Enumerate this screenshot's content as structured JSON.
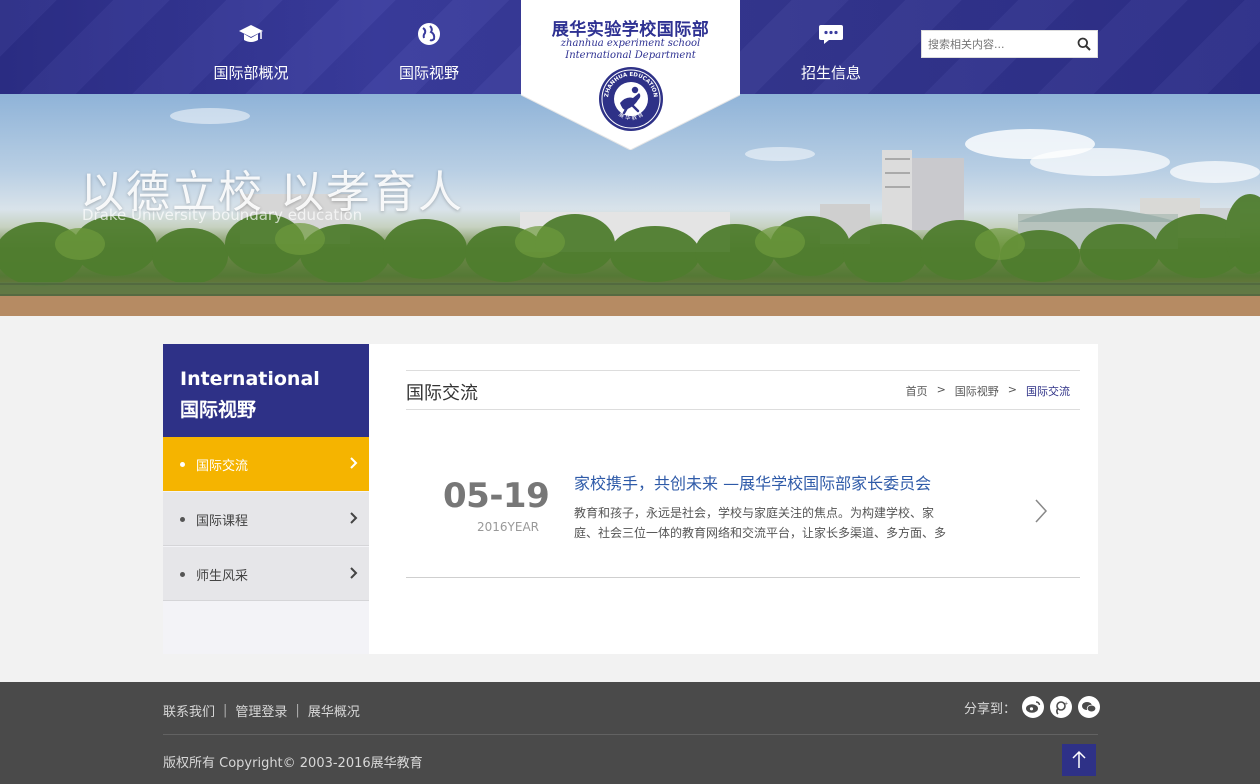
{
  "header": {
    "nav": [
      {
        "label": "国际部概况",
        "icon": "graduation-cap-icon"
      },
      {
        "label": "国际视野",
        "icon": "globe-icon"
      },
      {
        "label": "招生信息",
        "icon": "chat-bubble-icon"
      }
    ],
    "logo": {
      "title": "展华实验学校国际部",
      "subtitle_line1": "zhanhua experiment school",
      "subtitle_line2": "International Department",
      "emblem_text_top": "ZHANHUA EDUCATION",
      "emblem_text_bottom": "展 华 教 育"
    },
    "search": {
      "placeholder": "搜索相关内容...",
      "icon": "search-icon"
    }
  },
  "banner": {
    "slogan": "以德立校 以孝育人",
    "slogan_en": "Drake University boundary education"
  },
  "sidebar": {
    "heading_en": "International",
    "heading_cn": "国际视野",
    "items": [
      {
        "label": "国际交流",
        "active": true
      },
      {
        "label": "国际课程",
        "active": false
      },
      {
        "label": "师生风采",
        "active": false
      }
    ]
  },
  "content": {
    "title": "国际交流",
    "breadcrumb": [
      {
        "label": "首页"
      },
      {
        "label": ">"
      },
      {
        "label": "国际视野"
      },
      {
        "label": ">"
      },
      {
        "label": "国际交流"
      }
    ],
    "articles": [
      {
        "date_md": "05-19",
        "date_year": "2016YEAR",
        "title": "家校携手，共创未来 —展华学校国际部家长委员会",
        "excerpt": "教育和孩子，永远是社会，学校与家庭关注的焦点。为构建学校、家庭、社会三位一体的教育网络和交流平台，让家长多渠道、多方面、多"
      }
    ]
  },
  "footer": {
    "links": [
      {
        "label": "联系我们"
      },
      {
        "label": "管理登录"
      },
      {
        "label": "展华概况"
      }
    ],
    "share_label": "分享到：",
    "share_icons": [
      "weibo-icon",
      "tencent-weibo-icon",
      "wechat-icon"
    ],
    "copyright": "版权所有 Copyright© 2003-2016展华教育",
    "back_to_top_icon": "arrow-up-icon"
  },
  "colors": {
    "primary": "#2e3187",
    "accent": "#f5b400",
    "footer_bg": "#4a4a4a",
    "link_blue": "#2e5aa8"
  }
}
